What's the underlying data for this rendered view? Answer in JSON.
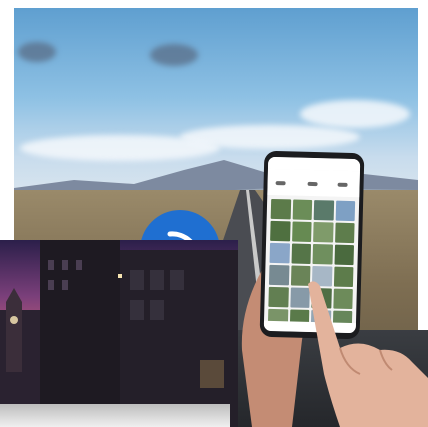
{
  "scene": {
    "background": "road-landscape",
    "overlays": [
      "city-street-photo",
      "wifi-badge",
      "smartphone",
      "pointing-hand"
    ]
  },
  "colors": {
    "sky_top": "#5f9fd0",
    "sky_bottom": "#dfe8ee",
    "wifi_badge": "#1f6fd1",
    "phone_body": "#1b1c1f",
    "city_sky": "#c65e7a"
  },
  "icons": {
    "wifi": "wifi-icon"
  },
  "phone": {
    "thumbnail_count": 24
  }
}
